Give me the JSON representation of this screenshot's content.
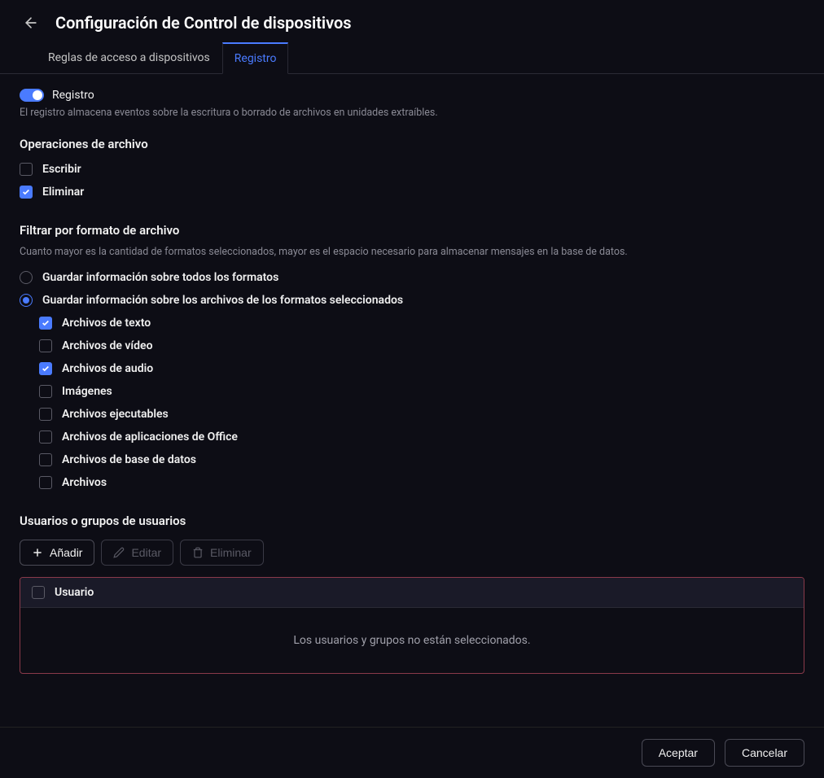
{
  "header": {
    "title": "Configuración de Control de dispositivos"
  },
  "tabs": {
    "access_rules": "Reglas de acceso a dispositivos",
    "log": "Registro"
  },
  "log": {
    "toggle_label": "Registro",
    "description": "El registro almacena eventos sobre la escritura o borrado de archivos en unidades extraíbles."
  },
  "file_ops": {
    "title": "Operaciones de archivo",
    "write": "Escribir",
    "delete": "Eliminar"
  },
  "filter": {
    "title": "Filtrar por formato de archivo",
    "description": "Cuanto mayor es la cantidad de formatos seleccionados, mayor es el espacio necesario para almacenar mensajes en la base de datos.",
    "all": "Guardar información sobre todos los formatos",
    "selected": "Guardar información sobre los archivos de los formatos seleccionados",
    "formats": {
      "text": "Archivos de texto",
      "video": "Archivos de vídeo",
      "audio": "Archivos de audio",
      "images": "Imágenes",
      "executables": "Archivos ejecutables",
      "office": "Archivos de aplicaciones de Office",
      "database": "Archivos de base de datos",
      "archives": "Archivos"
    }
  },
  "users": {
    "title": "Usuarios o grupos de usuarios",
    "add": "Añadir",
    "edit": "Editar",
    "delete": "Eliminar",
    "column_user": "Usuario",
    "empty": "Los usuarios y grupos no están seleccionados."
  },
  "footer": {
    "accept": "Aceptar",
    "cancel": "Cancelar"
  }
}
